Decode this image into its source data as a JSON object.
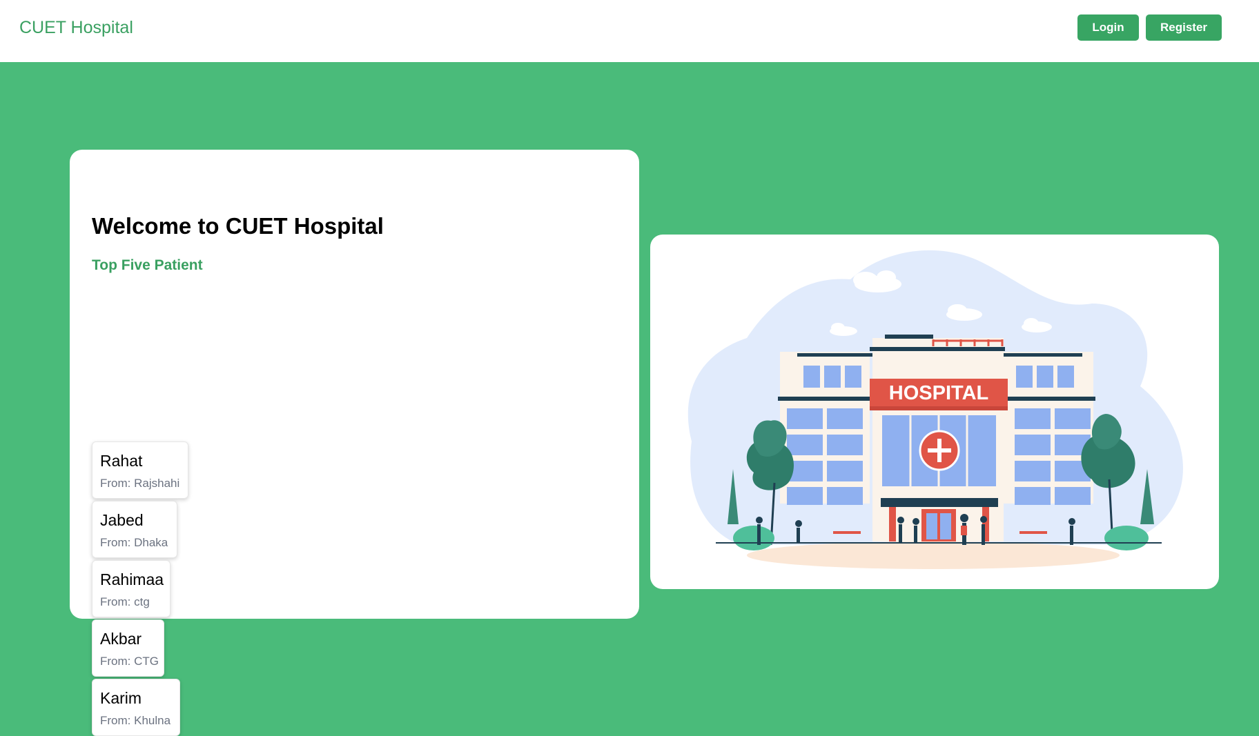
{
  "navbar": {
    "brand": "CUET Hospital",
    "login_label": "Login",
    "register_label": "Register"
  },
  "hero": {
    "title": "Welcome to CUET Hospital",
    "section_title": "Top Five Patient",
    "patients": [
      {
        "name": "Rahat",
        "from": "From: Rajshahi"
      },
      {
        "name": "Jabed",
        "from": "From: Dhaka"
      },
      {
        "name": "Rahimaa",
        "from": "From: ctg"
      },
      {
        "name": "Akbar",
        "from": "From: CTG"
      },
      {
        "name": "Karim",
        "from": "From: Khulna"
      }
    ]
  },
  "illustration": {
    "sign_text": "HOSPITAL",
    "icon": "hospital-building-icon"
  },
  "colors": {
    "brand_green": "#3aa061",
    "page_background": "#4abb7a",
    "button_green": "#38a563",
    "hospital_red": "#e05547"
  }
}
